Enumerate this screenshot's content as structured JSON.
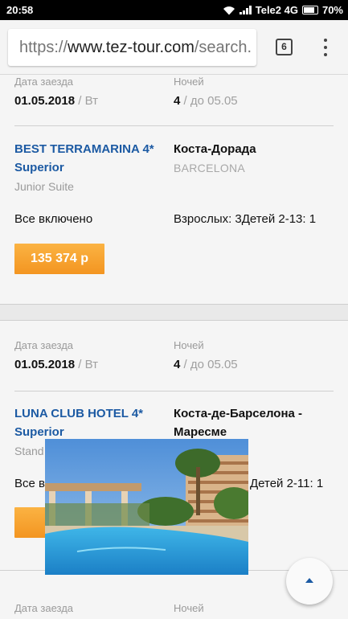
{
  "status_bar": {
    "time": "20:58",
    "carrier": "Tele2 4G",
    "battery": "70%"
  },
  "browser": {
    "url_scheme": "https://",
    "url_domain": "www.tez-tour.com",
    "url_path": "/search.",
    "tab_count": "6"
  },
  "cards": [
    {
      "checkin_label": "Дата заезда",
      "checkin_date": "01.05.2018",
      "checkin_day": "/ Вт",
      "nights_label": "Ночей",
      "nights": "4",
      "nights_until": "/ до 05.05"
    },
    {
      "hotel_name": "BEST TERRAMARINA 4* Superior",
      "room_type": "Junior Suite",
      "region": "Коста-Дорада",
      "city": "BARCELONA",
      "meal": "Все включено",
      "tourists": "Взрослых: 3Детей 2-13: 1",
      "price": "135 374 р"
    },
    {
      "checkin_label": "Дата заезда",
      "checkin_date": "01.05.2018",
      "checkin_day": "/ Вт",
      "nights_label": "Ночей",
      "nights": "4",
      "nights_until": "/ до 05.05",
      "hotel_name": "LUNA CLUB HOTEL 4* Superior",
      "room_type": "Stand",
      "region": "Коста-де-Барселона - Маресме",
      "meal": "Все в",
      "tourists": "Детей 2-11: 1",
      "price": "13"
    },
    {
      "checkin_label": "Дата заезда",
      "nights_label": "Ночей"
    }
  ],
  "colors": {
    "hotel_link": "#1c5aa3",
    "price_button": "#f7a532",
    "card_bg": "#f5f5f5"
  },
  "icons": [
    "wifi-icon",
    "signal-icon",
    "battery-icon",
    "tabs-icon",
    "overflow-menu-icon",
    "scroll-up-icon"
  ]
}
